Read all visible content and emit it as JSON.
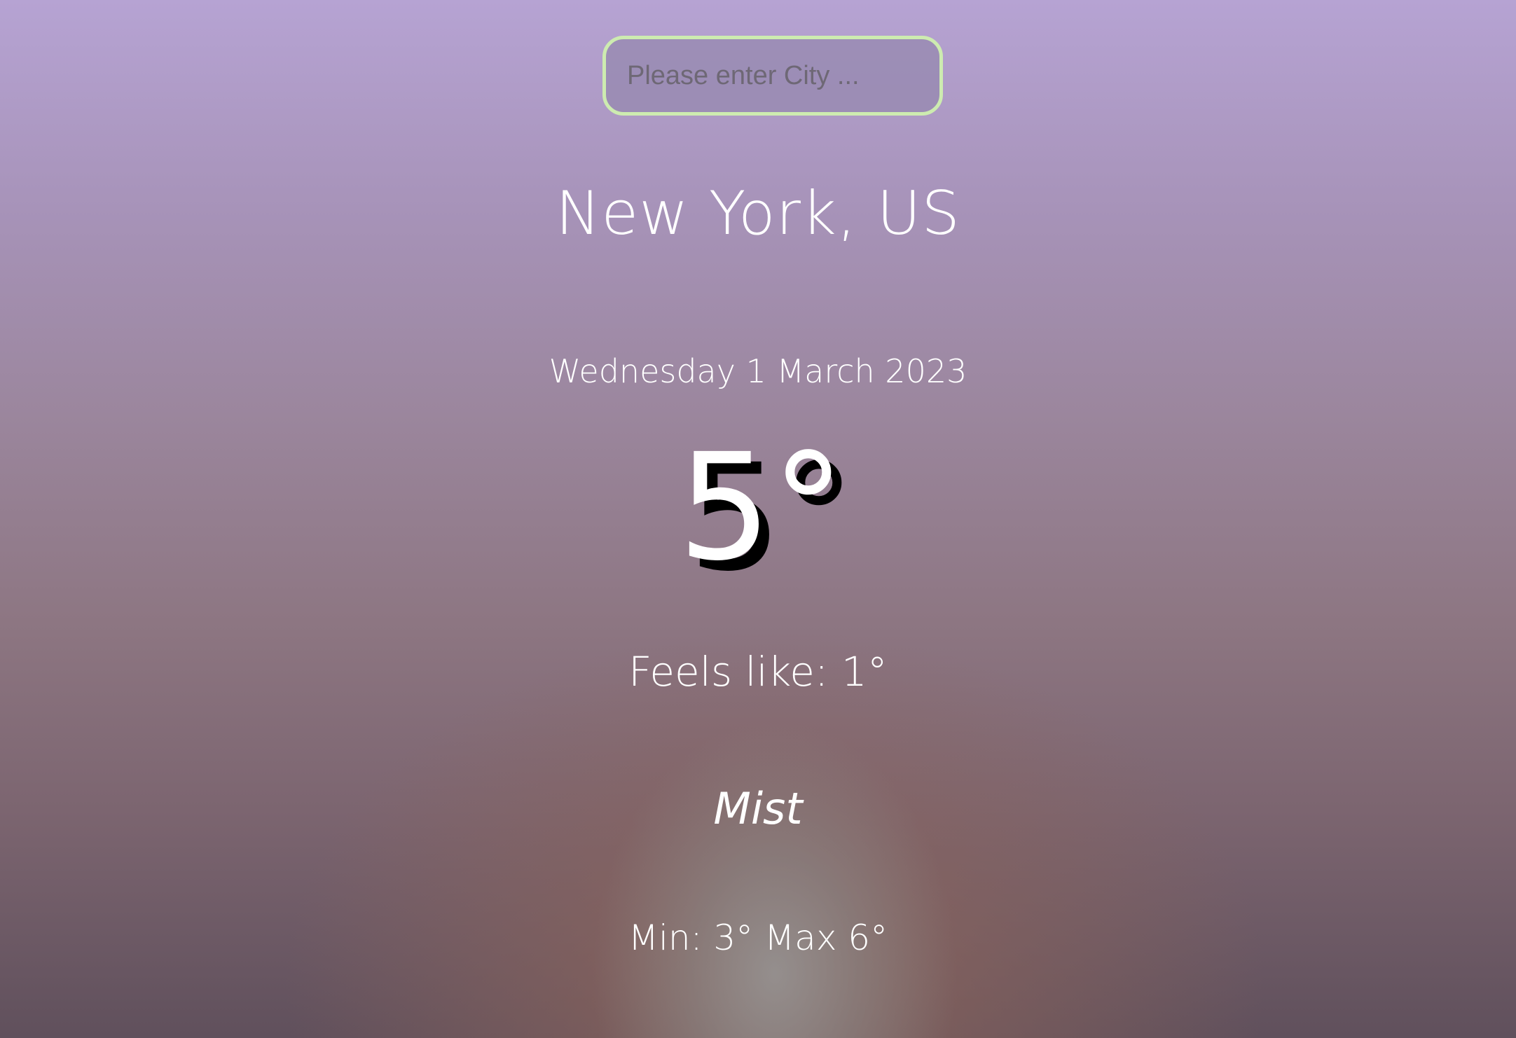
{
  "search": {
    "placeholder": "Please enter City ..."
  },
  "weather": {
    "location": "New York, US",
    "date": "Wednesday 1 March 2023",
    "temperature": "5°",
    "feels_like": "Feels like: 1°",
    "condition": "Mist",
    "min_max": "Min: 3° Max 6°"
  },
  "colors": {
    "search_border": "#cdebb0",
    "text": "#ffffff",
    "temp_shadow": "#000000"
  }
}
